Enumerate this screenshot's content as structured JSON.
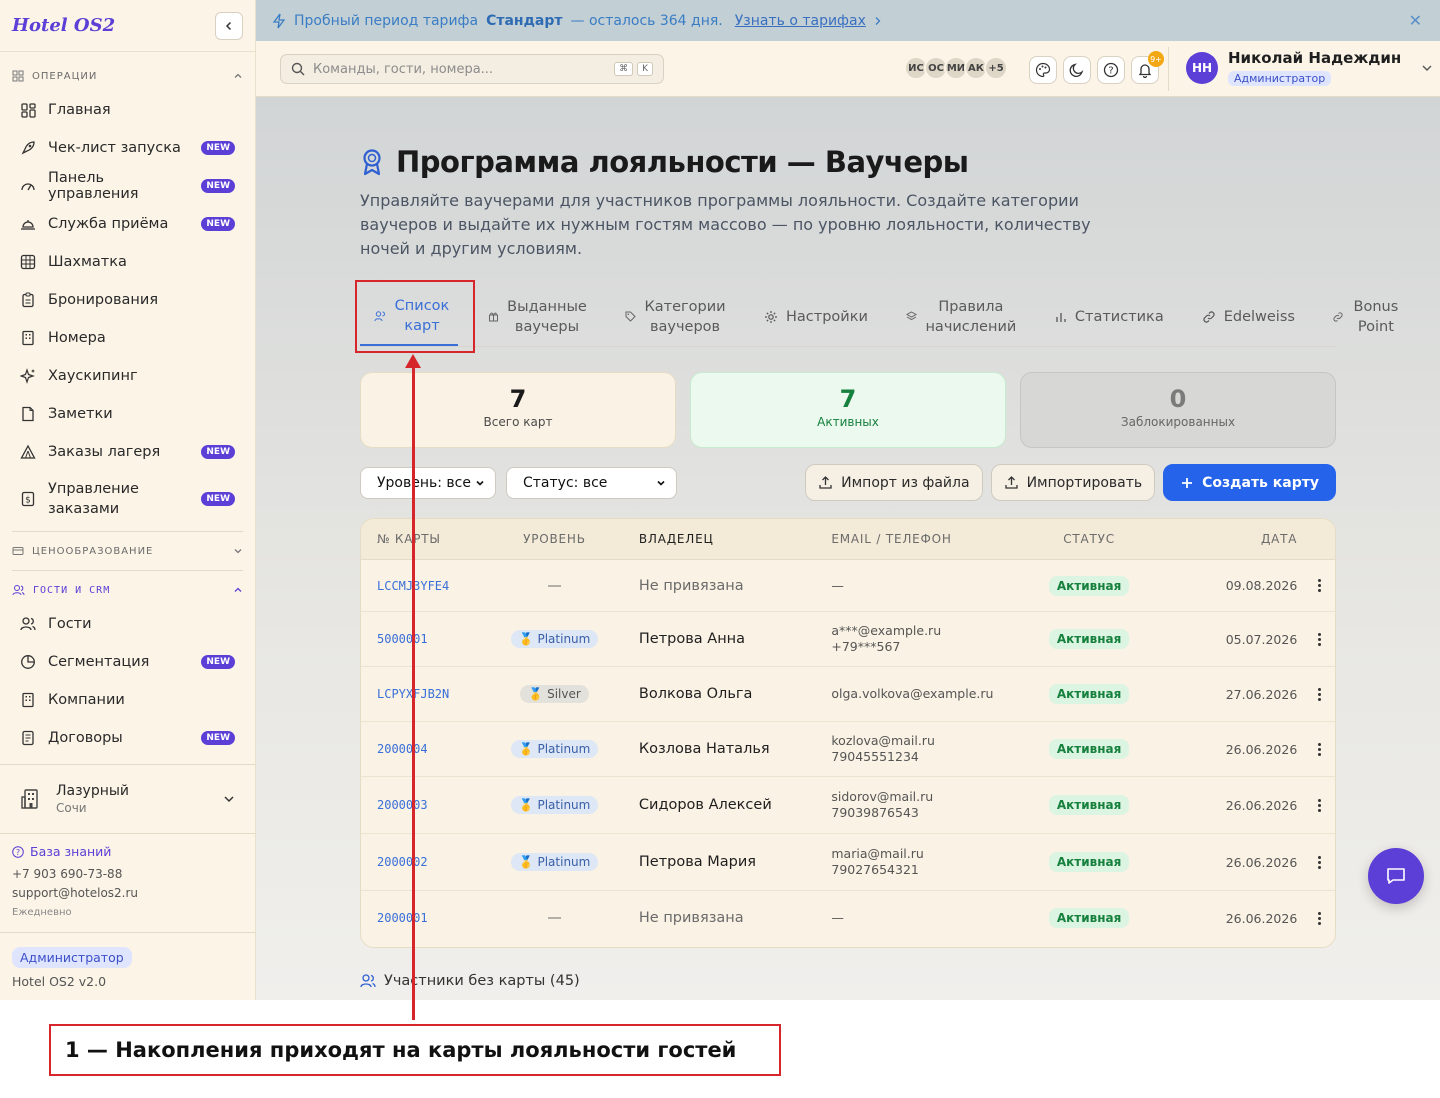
{
  "app": {
    "logo": "Hotel OS2"
  },
  "sidebar": {
    "sections": {
      "operations": "ОПЕРАЦИИ",
      "pricing": "ЦЕНООБРАЗОВАНИЕ",
      "crm": "ГОСТИ И CRM"
    },
    "badge_new": "NEW",
    "ops_items": [
      {
        "label": "Главная",
        "icon": "grid-icon",
        "new": false
      },
      {
        "label": "Чек-лист запуска",
        "icon": "rocket-icon",
        "new": true
      },
      {
        "label": "Панель управления",
        "icon": "gauge-icon",
        "new": true
      },
      {
        "label": "Служба приёма",
        "icon": "bell-desk-icon",
        "new": true
      },
      {
        "label": "Шахматка",
        "icon": "table-icon",
        "new": false
      },
      {
        "label": "Бронирования",
        "icon": "clipboard-icon",
        "new": false
      },
      {
        "label": "Номера",
        "icon": "building-icon",
        "new": false
      },
      {
        "label": "Хаускипинг",
        "icon": "sparkles-icon",
        "new": false
      },
      {
        "label": "Заметки",
        "icon": "note-icon",
        "new": false
      },
      {
        "label": "Заказы лагеря",
        "icon": "tent-icon",
        "new": true
      },
      {
        "label": "Управление заказами",
        "icon": "dollar-file-icon",
        "new": true
      }
    ],
    "crm_items": [
      {
        "label": "Гости",
        "icon": "users-icon",
        "new": false
      },
      {
        "label": "Сегментация",
        "icon": "pie-icon",
        "new": true
      },
      {
        "label": "Компании",
        "icon": "building-icon",
        "new": false
      },
      {
        "label": "Договоры",
        "icon": "contract-icon",
        "new": true
      }
    ],
    "hotel": {
      "name": "Лазурный",
      "city": "Сочи"
    },
    "support": {
      "kb": "База знаний",
      "phone": "+7 903 690-73-88",
      "email": "support@hotelos2.ru",
      "hours": "Ежедневно"
    },
    "role": "Администратор",
    "version": "Hotel OS2 v2.0"
  },
  "banner": {
    "prefix": "Пробный период тарифа",
    "plan": "Стандарт",
    "suffix": "— осталось 364 дня.",
    "link": "Узнать о тарифах"
  },
  "topbar": {
    "search_placeholder": "Команды, гости, номера...",
    "kbd": [
      "⌘",
      "K"
    ],
    "avatars": [
      "ИС",
      "ОС",
      "МИ",
      "АК",
      "+5"
    ],
    "notif_count": "9+",
    "user": {
      "initials": "НН",
      "name": "Николай Надеждин",
      "role": "Администратор"
    }
  },
  "page": {
    "title": "Программа лояльности — Ваучеры",
    "description": "Управляйте ваучерами для участников программы лояльности. Создайте категории ваучеров и выдайте их нужным гостям массово — по уровню лояльности, количеству ночей и другим условиям.",
    "tabs": [
      {
        "label": "Список карт",
        "icon": "users-icon"
      },
      {
        "label": "Выданные ваучеры",
        "icon": "gift-icon"
      },
      {
        "label": "Категории ваучеров",
        "icon": "tag-icon"
      },
      {
        "label": "Настройки",
        "icon": "gear-icon"
      },
      {
        "label": "Правила начислений",
        "icon": "layers-icon"
      },
      {
        "label": "Статистика",
        "icon": "bar-chart-icon"
      },
      {
        "label": "Edelweiss",
        "icon": "link-icon"
      },
      {
        "label": "Bonus Point",
        "icon": "link-icon"
      }
    ],
    "stats": [
      {
        "value": "7",
        "label": "Всего карт"
      },
      {
        "value": "7",
        "label": "Активных"
      },
      {
        "value": "0",
        "label": "Заблокированных"
      }
    ],
    "filters": {
      "level": "Уровень: все",
      "status": "Статус: все"
    },
    "buttons": {
      "import_file": "Импорт из файла",
      "import": "Импортировать",
      "create": "Создать карту"
    },
    "table": {
      "headers": [
        "№ КАРТЫ",
        "УРОВЕНЬ",
        "ВЛАДЕЛЕЦ",
        "EMAIL / ТЕЛЕФОН",
        "СТАТУС",
        "ДАТА"
      ],
      "rows": [
        {
          "card": "LCCMJ3YFE4",
          "level": "—",
          "owner": "Не привязана",
          "contact1": "—",
          "contact2": "",
          "status": "Активная",
          "date": "09.08.2026"
        },
        {
          "card": "5000001",
          "level": "Platinum",
          "owner": "Петрова Анна",
          "contact1": "a***@example.ru",
          "contact2": "+79***567",
          "status": "Активная",
          "date": "05.07.2026"
        },
        {
          "card": "LCPYXFJB2N",
          "level": "Silver",
          "owner": "Волкова Ольга",
          "contact1": "olga.volkova@example.ru",
          "contact2": "",
          "status": "Активная",
          "date": "27.06.2026"
        },
        {
          "card": "2000004",
          "level": "Platinum",
          "owner": "Козлова Наталья",
          "contact1": "kozlova@mail.ru",
          "contact2": "79045551234",
          "status": "Активная",
          "date": "26.06.2026"
        },
        {
          "card": "2000003",
          "level": "Platinum",
          "owner": "Сидоров Алексей",
          "contact1": "sidorov@mail.ru",
          "contact2": "79039876543",
          "status": "Активная",
          "date": "26.06.2026"
        },
        {
          "card": "2000002",
          "level": "Platinum",
          "owner": "Петрова Мария",
          "contact1": "maria@mail.ru",
          "contact2": "79027654321",
          "status": "Активная",
          "date": "26.06.2026"
        },
        {
          "card": "2000001",
          "level": "—",
          "owner": "Не привязана",
          "contact1": "—",
          "contact2": "",
          "status": "Активная",
          "date": "26.06.2026"
        }
      ]
    },
    "members": "Участники без карты (45)"
  },
  "annotation": {
    "caption": "1 — Накопления приходят на карты лояльности гостей"
  }
}
